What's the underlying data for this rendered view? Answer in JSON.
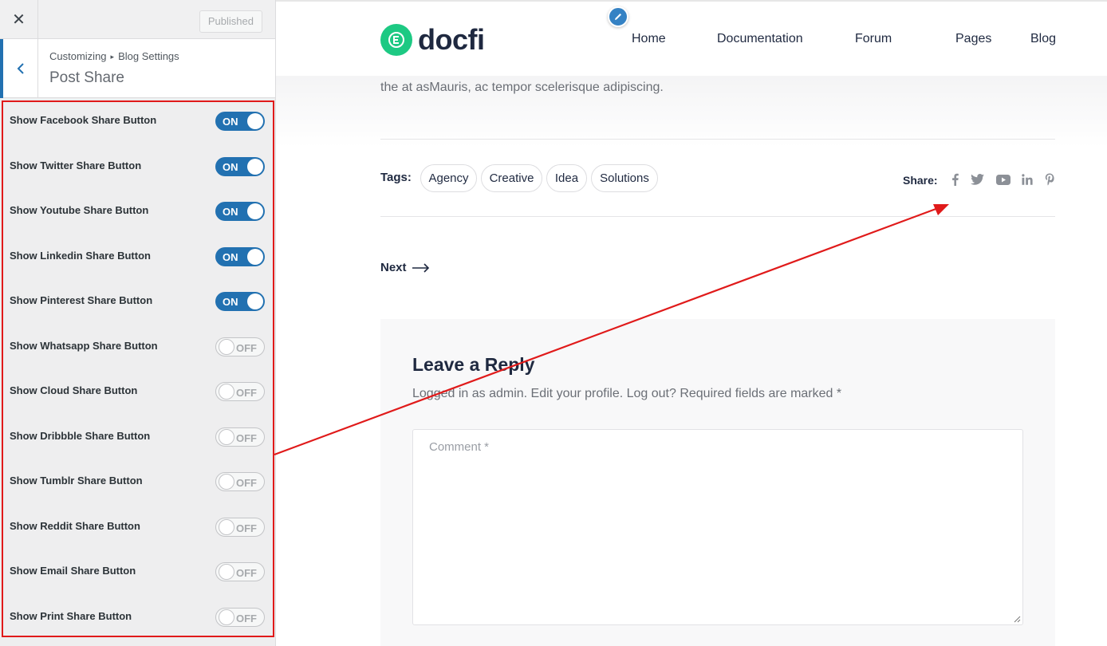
{
  "customizer": {
    "close_symbol": "✕",
    "published_label": "Published",
    "breadcrumb": {
      "root": "Customizing",
      "separator": "▸",
      "parent": "Blog Settings"
    },
    "section_title": "Post Share",
    "toggles": [
      {
        "label": "Show Facebook Share Button",
        "state": "ON"
      },
      {
        "label": "Show Twitter Share Button",
        "state": "ON"
      },
      {
        "label": "Show Youtube Share Button",
        "state": "ON"
      },
      {
        "label": "Show Linkedin Share Button",
        "state": "ON"
      },
      {
        "label": "Show Pinterest Share Button",
        "state": "ON"
      },
      {
        "label": "Show Whatsapp Share Button",
        "state": "OFF"
      },
      {
        "label": "Show Cloud Share Button",
        "state": "OFF"
      },
      {
        "label": "Show Dribbble Share Button",
        "state": "OFF"
      },
      {
        "label": "Show Tumblr Share Button",
        "state": "OFF"
      },
      {
        "label": "Show Reddit Share Button",
        "state": "OFF"
      },
      {
        "label": "Show Email Share Button",
        "state": "OFF"
      },
      {
        "label": "Show Print Share Button",
        "state": "OFF"
      }
    ]
  },
  "site": {
    "logo_text": "docfi",
    "nav": [
      "Home",
      "Documentation",
      "Forum",
      "Pages",
      "Blog"
    ],
    "excerpt": "the at asMauris, ac tempor scelerisque adipiscing.",
    "tags_label": "Tags:",
    "tags": [
      "Agency",
      "Creative",
      "Idea",
      "Solutions"
    ],
    "share_label": "Share:",
    "share_icons": [
      "facebook-icon",
      "twitter-icon",
      "youtube-icon",
      "linkedin-icon",
      "pinterest-icon"
    ],
    "next_label": "Next",
    "reply": {
      "title": "Leave a Reply",
      "meta": "Logged in as admin. Edit your profile. Log out? Required fields are marked *",
      "comment_placeholder": "Comment *"
    }
  },
  "colors": {
    "accent": "#2271b1",
    "brand_green": "#1dc983",
    "annotation_red": "#e01a1a"
  }
}
